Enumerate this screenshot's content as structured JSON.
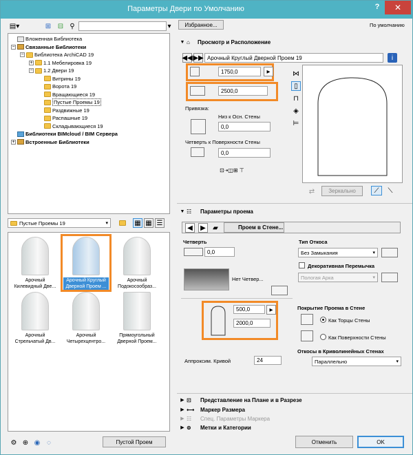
{
  "window": {
    "title": "Параметры Двери по Умолчанию",
    "help": "?",
    "close": "✕"
  },
  "left": {
    "search_placeholder": "",
    "tree": [
      {
        "label": "Вложенная Библиотека",
        "indent": 0,
        "icon": "book",
        "exp": "",
        "bold": false
      },
      {
        "label": "Связанные Библиотеки",
        "indent": 0,
        "icon": "lib",
        "exp": "−",
        "bold": true
      },
      {
        "label": "Библиотека ArchiCAD 19",
        "indent": 1,
        "icon": "folder",
        "exp": "−",
        "bold": false
      },
      {
        "label": "1.1 Мебелировка 19",
        "indent": 2,
        "icon": "folder",
        "exp": "+",
        "bold": false
      },
      {
        "label": "1.2 Двери 19",
        "indent": 2,
        "icon": "folder",
        "exp": "−",
        "bold": false
      },
      {
        "label": "Витрины 19",
        "indent": 3,
        "icon": "folder",
        "exp": "",
        "bold": false
      },
      {
        "label": "Ворота 19",
        "indent": 3,
        "icon": "folder",
        "exp": "",
        "bold": false
      },
      {
        "label": "Вращающиеся 19",
        "indent": 3,
        "icon": "folder",
        "exp": "",
        "bold": false
      },
      {
        "label": "Пустые Проемы 19",
        "indent": 3,
        "icon": "folder",
        "exp": "",
        "bold": false,
        "selected": true
      },
      {
        "label": "Раздвижные 19",
        "indent": 3,
        "icon": "folder",
        "exp": "",
        "bold": false
      },
      {
        "label": "Распашные 19",
        "indent": 3,
        "icon": "folder",
        "exp": "",
        "bold": false
      },
      {
        "label": "Складывающиеся 19",
        "indent": 3,
        "icon": "folder",
        "exp": "",
        "bold": false
      },
      {
        "label": "Библиотеки BIMcloud / BIM Сервера",
        "indent": 0,
        "icon": "bim",
        "exp": "",
        "bold": true
      },
      {
        "label": "Встроенные Библиотеки",
        "indent": 0,
        "icon": "lib",
        "exp": "+",
        "bold": true
      }
    ],
    "folder_select": "Пустые Проемы 19",
    "thumbs": [
      {
        "caption": "Арочный Килевидный Две...",
        "selected": false
      },
      {
        "caption": "Арочный Круглый Дверной Проем ...",
        "selected": true
      },
      {
        "caption": "Арочный Подокосообраз...",
        "selected": false
      },
      {
        "caption": "Арочный Стрельчатый Дв...",
        "selected": false
      },
      {
        "caption": "Арочный Четырехцентро...",
        "selected": false
      },
      {
        "caption": "Прямоугольный Дверной Проем...",
        "selected": false
      }
    ],
    "empty_btn": "Пустой Проем"
  },
  "right": {
    "favorites": "Избранное...",
    "default_label": "По умолчанию",
    "sec1": "Просмотр и Расположение",
    "object_name": "Арочный Круглый Дверной Проем 19",
    "width": "1750,0",
    "height": "2500,0",
    "anchor_label": "Привязка:",
    "anchor_value": "Низ к Осн. Стены",
    "anchor_num": "0,0",
    "reveal_label": "Четверть к Поверхности Стены",
    "reveal_num": "0,0",
    "mirror": "Зеркально",
    "sec2": "Параметры проема",
    "opening_tab": "Проем в Стене...",
    "quarter_label": "Четверть",
    "quarter_val": "0,0",
    "no_quarter": "Нет Четвер...",
    "reveal_type_label": "Тип Откоса",
    "reveal_type": "Без Замыкания",
    "decor_label": "Декоративная Перемычка",
    "decor_value": "Пологая Арка",
    "open_w": "500,0",
    "open_h": "2000,0",
    "cover_label": "Покрытие Проема в Стене",
    "radio1": "Как Торцы Стены",
    "radio2": "Как Поверхности Стены",
    "curved_label": "Откосы в Криволинейных Стенах",
    "curved_val": "Параллельно",
    "approx_label": "Аппроксим. Кривой",
    "approx_val": "24",
    "sec3": "Представление на Плане и в Разрезе",
    "sec4": "Маркер Размера",
    "sec5": "Спец. Параметры Маркера",
    "sec6": "Метки и Категории",
    "cancel": "Отменить",
    "ok": "OK"
  }
}
